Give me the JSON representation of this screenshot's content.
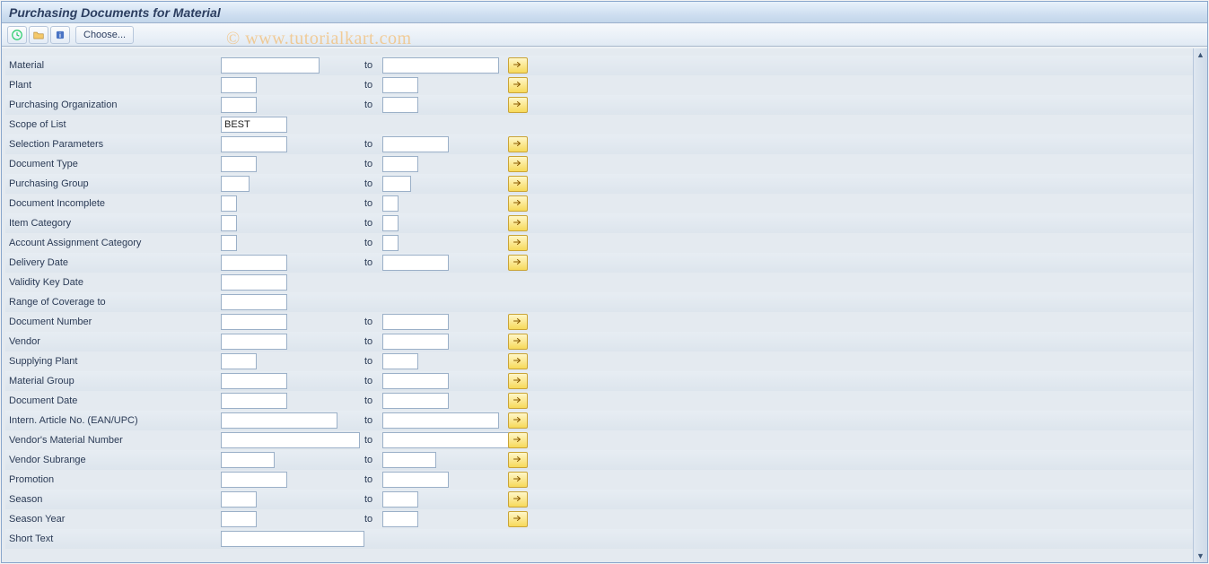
{
  "title": "Purchasing Documents for Material",
  "toolbar": {
    "choose_label": "Choose..."
  },
  "to_label": "to",
  "watermark": "© www.tutorialkart.com",
  "rows": [
    {
      "label": "Material",
      "from_w": 110,
      "to_w": 130,
      "more": true
    },
    {
      "label": "Plant",
      "from_w": 40,
      "to_w": 40,
      "more": true
    },
    {
      "label": "Purchasing Organization",
      "from_w": 40,
      "to_w": 40,
      "more": true
    },
    {
      "label": "Scope of List",
      "from_w": 74,
      "value": "BEST"
    },
    {
      "label": "Selection Parameters",
      "from_w": 74,
      "to_w": 74,
      "more": true
    },
    {
      "label": "Document Type",
      "from_w": 40,
      "to_w": 40,
      "more": true
    },
    {
      "label": "Purchasing Group",
      "from_w": 32,
      "to_w": 32,
      "more": true
    },
    {
      "label": "Document Incomplete",
      "from_w": 18,
      "to_w": 18,
      "more": true
    },
    {
      "label": "Item Category",
      "from_w": 18,
      "to_w": 18,
      "more": true
    },
    {
      "label": "Account Assignment Category",
      "from_w": 18,
      "to_w": 18,
      "more": true
    },
    {
      "label": "Delivery Date",
      "from_w": 74,
      "to_w": 74,
      "more": true
    },
    {
      "label": "Validity Key Date",
      "from_w": 74
    },
    {
      "label": "Range of Coverage to",
      "from_w": 74
    },
    {
      "label": "Document Number",
      "from_w": 74,
      "to_w": 74,
      "more": true
    },
    {
      "label": "Vendor",
      "from_w": 74,
      "to_w": 74,
      "more": true
    },
    {
      "label": "Supplying Plant",
      "from_w": 40,
      "to_w": 40,
      "more": true
    },
    {
      "label": "Material Group",
      "from_w": 74,
      "to_w": 74,
      "more": true
    },
    {
      "label": "Document Date",
      "from_w": 74,
      "to_w": 74,
      "more": true
    },
    {
      "label": "Intern. Article No. (EAN/UPC)",
      "from_w": 130,
      "to_w": 130,
      "more": true
    },
    {
      "label": "Vendor's Material Number",
      "from_w": 155,
      "to_w": 155,
      "more": true
    },
    {
      "label": "Vendor Subrange",
      "from_w": 60,
      "to_w": 60,
      "more": true
    },
    {
      "label": "Promotion",
      "from_w": 74,
      "to_w": 74,
      "more": true
    },
    {
      "label": "Season",
      "from_w": 40,
      "to_w": 40,
      "more": true
    },
    {
      "label": "Season Year",
      "from_w": 40,
      "to_w": 40,
      "more": true
    },
    {
      "label": "Short Text",
      "from_w": 300
    }
  ]
}
